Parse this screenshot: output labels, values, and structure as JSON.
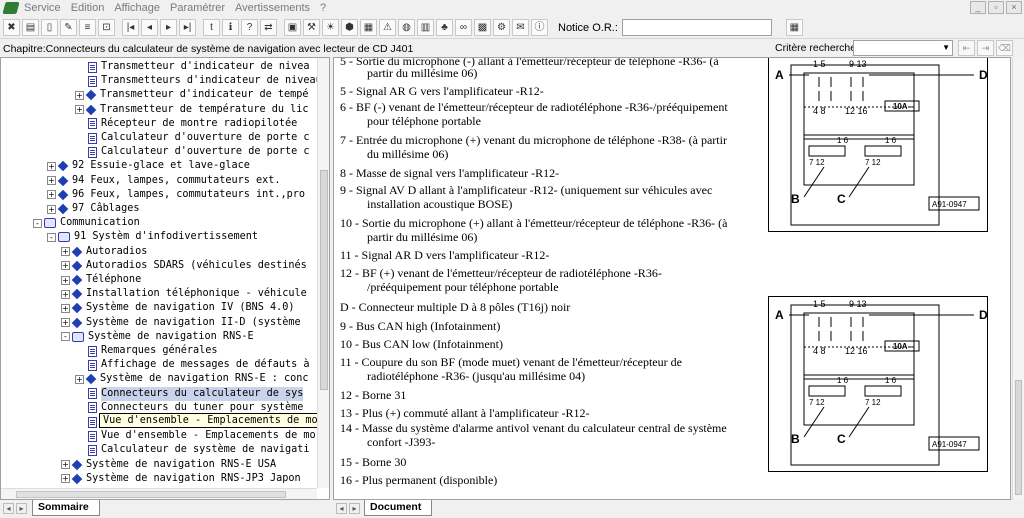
{
  "menubar": {
    "items": [
      "Service",
      "Edition",
      "Affichage",
      "Paramétrer",
      "Avertissements",
      "?"
    ]
  },
  "toolbar": {
    "notice_label": "Notice O.R.:",
    "notice_value": ""
  },
  "chapter": {
    "title": "Chapitre:Connecteurs du  calculateur de système de navigation avec lecteur de CD J401",
    "criteria_label": "Critère recherche:",
    "criteria_value": ""
  },
  "tree": {
    "rows": [
      {
        "text": "Transmetteur d'indicateur de nivea",
        "icon": "doc",
        "level": 4,
        "expander": ""
      },
      {
        "text": "Transmetteurs d'indicateur de niveau de carbura",
        "icon": "doc",
        "level": 4,
        "expander": ""
      },
      {
        "text": "Transmetteur d'indicateur de tempé",
        "icon": "dia",
        "level": 4,
        "expander": "+"
      },
      {
        "text": "Transmetteur de température du lic",
        "icon": "dia",
        "level": 4,
        "expander": "+"
      },
      {
        "text": "Récepteur de montre radiopilotée ",
        "icon": "doc",
        "level": 4,
        "expander": ""
      },
      {
        "text": "Calculateur d'ouverture de porte c",
        "icon": "doc",
        "level": 4,
        "expander": ""
      },
      {
        "text": "Calculateur d'ouverture de porte c",
        "icon": "doc",
        "level": 4,
        "expander": ""
      },
      {
        "text": "92 Essuie-glace et lave-glace",
        "icon": "dia",
        "level": 2,
        "expander": "+"
      },
      {
        "text": "94 Feux, lampes, commutateurs ext.",
        "icon": "dia",
        "level": 2,
        "expander": "+"
      },
      {
        "text": "96 Feux, lampes, commutateurs int.,pro",
        "icon": "dia",
        "level": 2,
        "expander": "+"
      },
      {
        "text": "97 Câblages",
        "icon": "dia",
        "level": 2,
        "expander": "+"
      },
      {
        "text": "Communication",
        "icon": "book",
        "level": 1,
        "expander": "-"
      },
      {
        "text": "91 Systèm d'infodivertissement",
        "icon": "book",
        "level": 2,
        "expander": "-"
      },
      {
        "text": "Autoradios",
        "icon": "dia",
        "level": 3,
        "expander": "+"
      },
      {
        "text": "Autoradios SDARS (véhicules destinés",
        "icon": "dia",
        "level": 3,
        "expander": "+"
      },
      {
        "text": "Téléphone",
        "icon": "dia",
        "level": 3,
        "expander": "+"
      },
      {
        "text": "Installation téléphonique - véhicule",
        "icon": "dia",
        "level": 3,
        "expander": "+"
      },
      {
        "text": "Système de navigation IV (BNS 4.0)",
        "icon": "dia",
        "level": 3,
        "expander": "+"
      },
      {
        "text": "Système de navigation II-D (système",
        "icon": "dia",
        "level": 3,
        "expander": "+"
      },
      {
        "text": "Système de navigation RNS-E",
        "icon": "book",
        "level": 3,
        "expander": "-"
      },
      {
        "text": "Remarques générales",
        "icon": "doc",
        "level": 4,
        "expander": ""
      },
      {
        "text": "Affichage de messages de défauts à",
        "icon": "doc",
        "level": 4,
        "expander": ""
      },
      {
        "text": "Système de navigation RNS-E : conc",
        "icon": "dia",
        "level": 4,
        "expander": "+"
      },
      {
        "text": "Connecteurs du  calculateur de sys",
        "icon": "doc",
        "level": 4,
        "expander": "",
        "selected": true
      },
      {
        "text": "Connecteurs du  tuner pour système",
        "icon": "doc",
        "level": 4,
        "expander": ""
      },
      {
        "text": "Vue d'ensemble - Emplacements de mo",
        "icon": "doc",
        "level": 4,
        "expander": ""
      },
      {
        "text": "Vue d'ensemble - Emplacements de mo",
        "icon": "doc",
        "level": 4,
        "expander": ""
      },
      {
        "text": "Calculateur de système de navigati",
        "icon": "doc",
        "level": 4,
        "expander": ""
      },
      {
        "text": "Système de navigation RNS-E USA",
        "icon": "dia",
        "level": 3,
        "expander": "+"
      },
      {
        "text": "Système de navigation RNS-JP3 Japon",
        "icon": "dia",
        "level": 3,
        "expander": "+"
      }
    ],
    "tooltip": "Vue d'ensemble - Emplacements de montage sur la berline"
  },
  "document": {
    "lines": [
      {
        "text": "5 -  Sortie du microphone (-) allant à l'émetteur/récepteur de téléphone -R36- (à",
        "cont": false
      },
      {
        "text": "partir du millésime 06)",
        "cont": true
      },
      {
        "text": "5 -  Signal AR G vers l'amplificateur -R12-",
        "cont": false
      },
      {
        "text": "6 -  BF (-) venant de l'émetteur/récepteur de radiotéléphone -R36-/prééquipement",
        "cont": false
      },
      {
        "text": "pour téléphone portable",
        "cont": true
      },
      {
        "text": "7 -  Entrée du microphone (+) venant du microphone de téléphone -R38- (à partir",
        "cont": false
      },
      {
        "text": "du millésime 06)",
        "cont": true
      },
      {
        "text": "8 -  Masse de signal vers l'amplificateur -R12-",
        "cont": false
      },
      {
        "text": "9 -  Signal AV D allant à l'amplificateur -R12- (uniquement sur véhicules avec",
        "cont": false
      },
      {
        "text": "installation acoustique BOSE)",
        "cont": true
      },
      {
        "text": "10 -  Sortie du microphone (+) allant à l'émetteur/récepteur de téléphone -R36- (à",
        "cont": false
      },
      {
        "text": "partir du millésime 06)",
        "cont": true
      },
      {
        "text": "11 -  Signal AR D vers l'amplificateur -R12-",
        "cont": false
      },
      {
        "text": "12 -  BF (+) venant de l'émetteur/récepteur de radiotéléphone -R36-",
        "cont": false
      },
      {
        "text": "/prééquipement pour téléphone portable",
        "cont": true
      },
      {
        "text": "D - Connecteur multiple D à 8 pôles (T16j) noir",
        "cont": false
      },
      {
        "text": "9 -  Bus CAN high (Infotainment)",
        "cont": false
      },
      {
        "text": "10 -  Bus CAN low (Infotainment)",
        "cont": false
      },
      {
        "text": "11 -  Coupure du son BF (mode muet) venant de l'émetteur/récepteur de",
        "cont": false
      },
      {
        "text": "radiotéléphone -R36- (jusqu'au millésime 04)",
        "cont": true
      },
      {
        "text": "12 -  Borne 31",
        "cont": false
      },
      {
        "text": "13 -  Plus (+) commuté allant à l'amplificateur -R12-",
        "cont": false
      },
      {
        "text": "14 -  Masse du système d'alarme antivol venant du calculateur central de système",
        "cont": false
      },
      {
        "text": "confort -J393-",
        "cont": true
      },
      {
        "text": "15 -  Borne 30",
        "cont": false
      },
      {
        "text": "16 -  Plus permanent (disponible)",
        "cont": false
      }
    ]
  },
  "diagram": {
    "labels": {
      "a": "A",
      "b": "B",
      "c": "C",
      "d": "D"
    },
    "pins_top_left": "1  5",
    "pins_top_mid": "9  13",
    "pins_bot_left": "4  8",
    "pins_bot_mid": "12  16",
    "fuse": "- 10A -",
    "pins_lower_1": "1     6",
    "pins_lower_2": "1     6",
    "pins_lower_3": "7     12",
    "pins_lower_4": "7     12",
    "ref": "A91-0947"
  },
  "tabs": {
    "left": "Sommaire",
    "right": "Document"
  }
}
